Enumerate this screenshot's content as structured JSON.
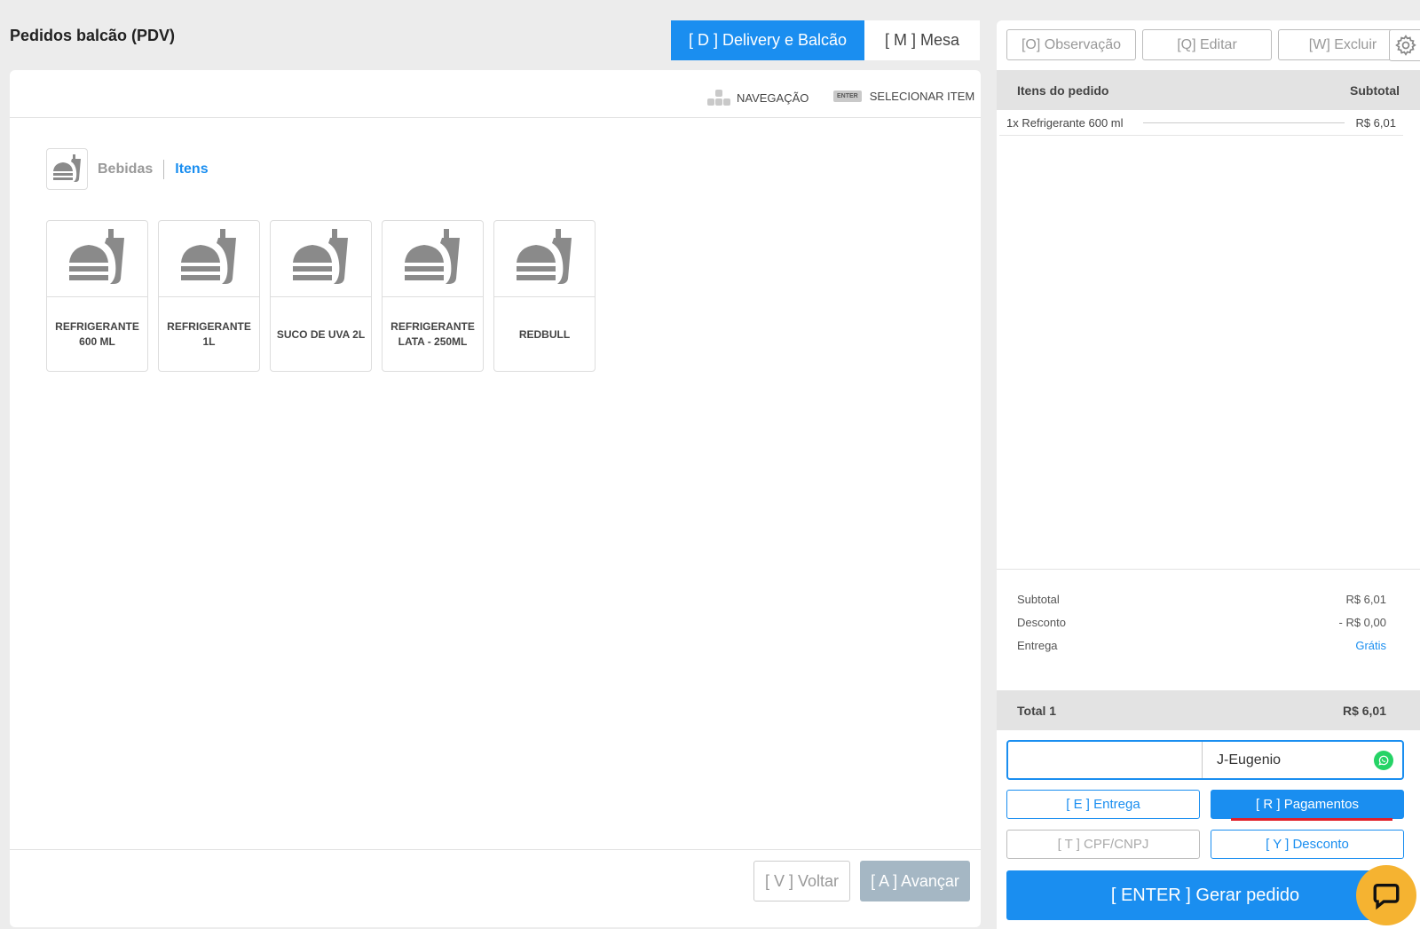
{
  "header": {
    "title": "Pedidos balcão (PDV)",
    "tabs": [
      {
        "label": "[ D ] Delivery e Balcão",
        "active": true
      },
      {
        "label": "[ M ] Mesa",
        "active": false
      }
    ]
  },
  "hints": {
    "navigation": "NAVEGAÇÃO",
    "enter_key": "ENTER",
    "select_item": "SELECIONAR ITEM"
  },
  "breadcrumb": {
    "category": "Bebidas",
    "current": "Itens",
    "icon": "food-drink-icon"
  },
  "products": [
    {
      "name": "REFRIGERANTE 600 ML",
      "icon": "food-drink-icon"
    },
    {
      "name": "REFRIGERANTE 1L",
      "icon": "food-drink-icon"
    },
    {
      "name": "SUCO DE UVA 2L",
      "icon": "food-drink-icon"
    },
    {
      "name": "REFRIGERANTE LATA - 250ML",
      "icon": "food-drink-icon"
    },
    {
      "name": "REDBULL",
      "icon": "food-drink-icon"
    }
  ],
  "footer": {
    "back_label": "[ V ] Voltar",
    "next_label": "[ A ] Avançar"
  },
  "order": {
    "actions": [
      "[O] Observação",
      "[Q] Editar",
      "[W] Excluir"
    ],
    "items_header": "Itens do pedido",
    "subtotal_header": "Subtotal",
    "items": [
      {
        "desc": "1x Refrigerante 600 ml",
        "price": "R$ 6,01"
      }
    ],
    "summary": {
      "subtotal_label": "Subtotal",
      "subtotal_value": "R$ 6,01",
      "discount_label": "Desconto",
      "discount_value": "- R$ 0,00",
      "delivery_label": "Entrega",
      "delivery_value": "Grátis"
    },
    "total_label": "Total 1",
    "total_value": "R$ 6,01",
    "customer_name": "J-Eugenio",
    "buttons": {
      "delivery": "[ E ] Entrega",
      "payments": "[ R ] Pagamentos",
      "cpf": "[ T ] CPF/CNPJ",
      "discount": "[ Y ] Desconto"
    },
    "generate_label": "[ ENTER ] Gerar pedido"
  },
  "colors": {
    "accent": "#1a8ef0",
    "disabled": "#a5b7c4",
    "chat": "#f5b331",
    "whatsapp": "#25d366"
  }
}
